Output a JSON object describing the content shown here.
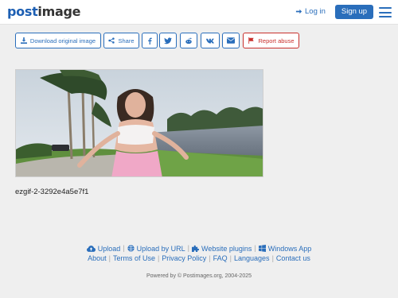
{
  "header": {
    "logo_part1": "post",
    "logo_part2": "image",
    "login_label": "Log in",
    "signup_label": "Sign up"
  },
  "toolbar": {
    "download_label": "Download original image",
    "share_label": "Share",
    "report_label": "Report abuse",
    "social_icons": [
      "facebook-icon",
      "twitter-icon",
      "reddit-icon",
      "vk-icon",
      "email-icon"
    ]
  },
  "image": {
    "filename": "ezgif-2-3292e4a5e7f1"
  },
  "footer": {
    "row1": [
      "Upload",
      "Upload by URL",
      "Website plugins",
      "Windows App"
    ],
    "row2": [
      "About",
      "Terms of Use",
      "Privacy Policy",
      "FAQ",
      "Languages",
      "Contact us"
    ],
    "copyright": "Powered by © Postimages.org, 2004-2025"
  },
  "colors": {
    "brand": "#2a6ebb",
    "report": "#c9302c",
    "background": "#efefef"
  }
}
